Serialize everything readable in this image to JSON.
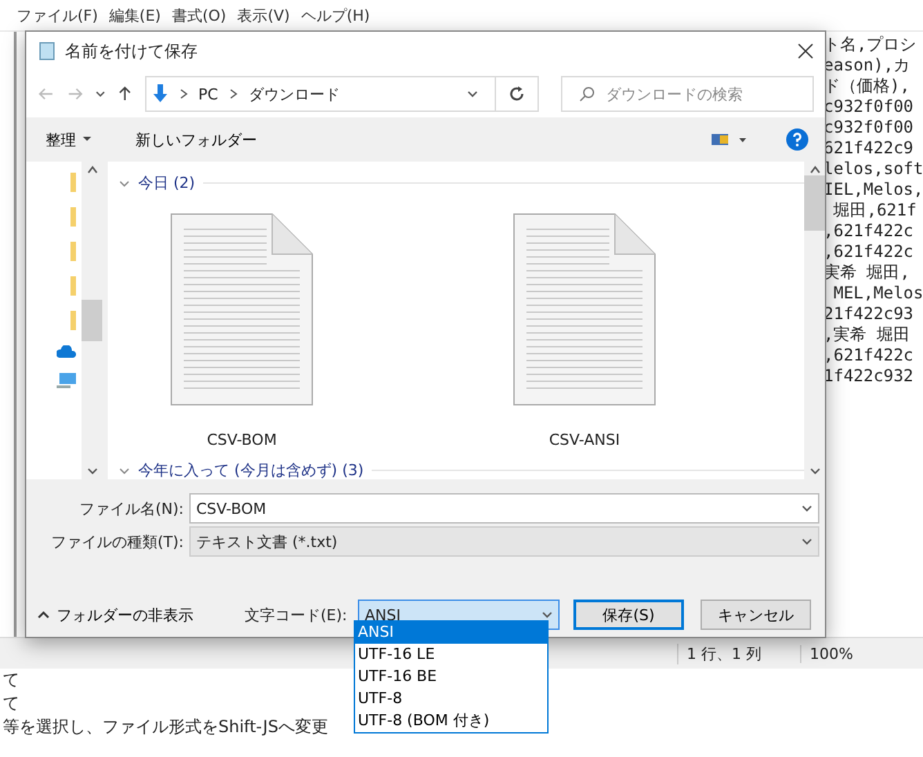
{
  "notepad": {
    "menu": [
      "ファイル(F)",
      "編集(E)",
      "書式(O)",
      "表示(V)",
      "ヘルプ(H)"
    ],
    "lines": [
      "ト名,プロシ",
      "eason),カ",
      "ド（価格),",
      "c932f0f00",
      "c932f0f00",
      "621f422c9",
      "lelos,soft",
      "IEL,Melos,",
      " 堀田,621f",
      ",621f422c",
      ",621f422c",
      "実希 堀田,",
      " MEL,Melos",
      "21f422c93",
      ",実希 堀田",
      ",621f422c",
      "1f422c932"
    ],
    "status": [
      "1 行、1 列",
      "100%"
    ]
  },
  "web_text": [
    "て",
    "て",
    "等を選択し、ファイル形式をShift-JSへ変更"
  ],
  "dialog": {
    "title": "名前を付けて保存",
    "path": [
      "PC",
      "ダウンロード"
    ],
    "search": {
      "placeholder": "ダウンロードの検索"
    },
    "toolbar": {
      "organize": "整理",
      "new_folder": "新しいフォルダー"
    },
    "groups": [
      {
        "label": "今日 (2)",
        "expanded": true,
        "files": [
          "CSV-BOM",
          "CSV-ANSI"
        ]
      },
      {
        "label": "今年に入って (今月は含めず) (3)",
        "expanded": true
      }
    ],
    "file_name": {
      "label": "ファイル名(N):",
      "value": "CSV-BOM"
    },
    "file_type": {
      "label": "ファイルの種類(T):",
      "value": "テキスト文書 (*.txt)"
    },
    "hide_folders": "フォルダーの非表示",
    "encoding": {
      "label": "文字コード(E):",
      "value": "ANSI",
      "expanded": true,
      "options": [
        {
          "label": "ANSI",
          "selected": true
        },
        {
          "label": "UTF-16 LE",
          "selected": false
        },
        {
          "label": "UTF-16 BE",
          "selected": false
        },
        {
          "label": "UTF-8",
          "selected": false
        },
        {
          "label": "UTF-8 (BOM 付き)",
          "selected": false
        }
      ]
    },
    "buttons": [
      {
        "label": "保存(S)",
        "kind": "primary"
      },
      {
        "label": "キャンセル",
        "kind": "normal"
      }
    ]
  }
}
